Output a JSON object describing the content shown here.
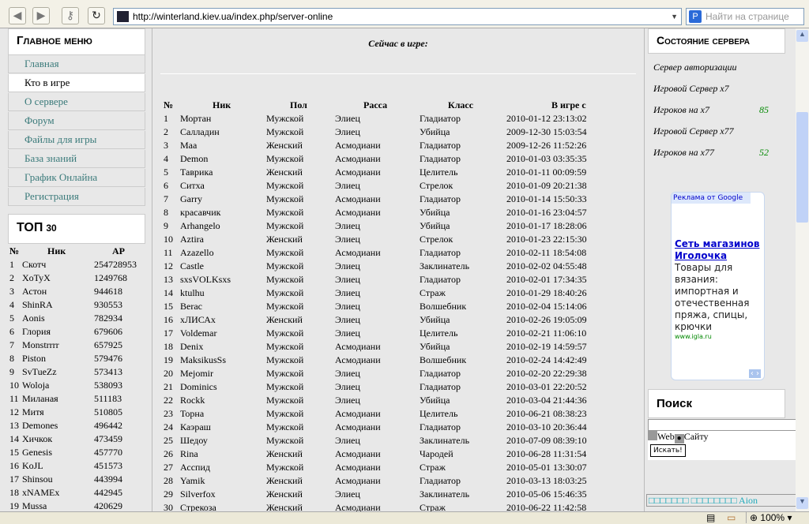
{
  "browser": {
    "url": "http://winterland.kiev.ua/index.php/server-online",
    "find_placeholder": "Найти на странице",
    "zoom": "100%"
  },
  "menu": {
    "title": "Главное меню",
    "items": [
      {
        "label": "Главная"
      },
      {
        "label": "Кто в игре",
        "active": true
      },
      {
        "label": "О сервере"
      },
      {
        "label": "Форум"
      },
      {
        "label": "Файлы для игры"
      },
      {
        "label": "База знаний"
      },
      {
        "label": "График Онлайна"
      },
      {
        "label": "Регистрация"
      }
    ]
  },
  "top": {
    "title": "ТОП",
    "count": "30",
    "headers": [
      "№",
      "Ник",
      "AP"
    ],
    "rows": [
      [
        "1",
        "Скотч",
        "254728953"
      ],
      [
        "2",
        "XoTyX",
        "1249768"
      ],
      [
        "3",
        "Астон",
        "944618"
      ],
      [
        "4",
        "ShinRA",
        "930553"
      ],
      [
        "5",
        "Aonis",
        "782934"
      ],
      [
        "6",
        "Глория",
        "679606"
      ],
      [
        "7",
        "Monstrrrr",
        "657925"
      ],
      [
        "8",
        "Piston",
        "579476"
      ],
      [
        "9",
        "SvTueZz",
        "573413"
      ],
      [
        "10",
        "Woloja",
        "538093"
      ],
      [
        "11",
        "Миланая",
        "511183"
      ],
      [
        "12",
        "Митя",
        "510805"
      ],
      [
        "13",
        "Demones",
        "496442"
      ],
      [
        "14",
        "Хичкок",
        "473459"
      ],
      [
        "15",
        "Genesis",
        "457770"
      ],
      [
        "16",
        "KoJL",
        "451573"
      ],
      [
        "17",
        "Shinsou",
        "443994"
      ],
      [
        "18",
        "xNAMEx",
        "442945"
      ],
      [
        "19",
        "Mussa",
        "420629"
      ]
    ]
  },
  "online": {
    "title": "Сейчас в игре:",
    "headers": [
      "№",
      "Ник",
      "Пол",
      "Расса",
      "Класс",
      "В игре с"
    ],
    "rows": [
      [
        "1",
        "Мортан",
        "Мужской",
        "Элиец",
        "Гладиатор",
        "2010-01-12 23:13:02"
      ],
      [
        "2",
        "Салладин",
        "Мужской",
        "Элиец",
        "Убийца",
        "2009-12-30 15:03:54"
      ],
      [
        "3",
        "Маа",
        "Женский",
        "Асмодиани",
        "Гладиатор",
        "2009-12-26 11:52:26"
      ],
      [
        "4",
        "Demon",
        "Мужской",
        "Асмодиани",
        "Гладиатор",
        "2010-01-03 03:35:35"
      ],
      [
        "5",
        "Таврика",
        "Женский",
        "Асмодиани",
        "Целитель",
        "2010-01-11 00:09:59"
      ],
      [
        "6",
        "Ситха",
        "Мужской",
        "Элиец",
        "Стрелок",
        "2010-01-09 20:21:38"
      ],
      [
        "7",
        "Garry",
        "Мужской",
        "Асмодиани",
        "Гладиатор",
        "2010-01-14 15:50:33"
      ],
      [
        "8",
        "красавчик",
        "Мужской",
        "Асмодиани",
        "Убийца",
        "2010-01-16 23:04:57"
      ],
      [
        "9",
        "Arhangelo",
        "Мужской",
        "Элиец",
        "Убийца",
        "2010-01-17 18:28:06"
      ],
      [
        "10",
        "Aztira",
        "Женский",
        "Элиец",
        "Стрелок",
        "2010-01-23 22:15:30"
      ],
      [
        "11",
        "Azazello",
        "Мужской",
        "Асмодиани",
        "Гладиатор",
        "2010-02-11 18:54:08"
      ],
      [
        "12",
        "Castle",
        "Мужской",
        "Элиец",
        "Заклинатель",
        "2010-02-02 04:55:48"
      ],
      [
        "13",
        "sxsVOLKsxs",
        "Мужской",
        "Элиец",
        "Гладиатор",
        "2010-02-01 17:34:35"
      ],
      [
        "14",
        "ktulhu",
        "Мужской",
        "Элиец",
        "Страж",
        "2010-01-29 18:40:26"
      ],
      [
        "15",
        "Berac",
        "Мужской",
        "Элиец",
        "Волшебник",
        "2010-02-04 15:14:06"
      ],
      [
        "16",
        "xЛИСАx",
        "Женский",
        "Элиец",
        "Убийца",
        "2010-02-26 19:05:09"
      ],
      [
        "17",
        "Voldemar",
        "Мужской",
        "Элиец",
        "Целитель",
        "2010-02-21 11:06:10"
      ],
      [
        "18",
        "Denix",
        "Мужской",
        "Асмодиани",
        "Убийца",
        "2010-02-19 14:59:57"
      ],
      [
        "19",
        "MaksikusSs",
        "Мужской",
        "Асмодиани",
        "Волшебник",
        "2010-02-24 14:42:49"
      ],
      [
        "20",
        "Mejomir",
        "Мужской",
        "Элиец",
        "Гладиатор",
        "2010-02-20 22:29:38"
      ],
      [
        "21",
        "Dominics",
        "Мужской",
        "Элиец",
        "Гладиатор",
        "2010-03-01 22:20:52"
      ],
      [
        "22",
        "Rockk",
        "Мужской",
        "Элиец",
        "Убийца",
        "2010-03-04 21:44:36"
      ],
      [
        "23",
        "Торна",
        "Мужской",
        "Асмодиани",
        "Целитель",
        "2010-06-21 08:38:23"
      ],
      [
        "24",
        "Каэраш",
        "Мужской",
        "Асмодиани",
        "Гладиатор",
        "2010-03-10 20:36:44"
      ],
      [
        "25",
        "Шедоу",
        "Мужской",
        "Элиец",
        "Заклинатель",
        "2010-07-09 08:39:10"
      ],
      [
        "26",
        "Rina",
        "Женский",
        "Асмодиани",
        "Чародей",
        "2010-06-28 11:31:54"
      ],
      [
        "27",
        "Асспид",
        "Мужской",
        "Асмодиани",
        "Страж",
        "2010-05-01 13:30:07"
      ],
      [
        "28",
        "Yamik",
        "Женский",
        "Асмодиани",
        "Гладиатор",
        "2010-03-13 18:03:25"
      ],
      [
        "29",
        "Silverfox",
        "Женский",
        "Элиец",
        "Заклинатель",
        "2010-05-06 15:46:35"
      ],
      [
        "30",
        "Стрекоза",
        "Женский",
        "Асмодиани",
        "Страж",
        "2010-06-22 11:42:58"
      ]
    ]
  },
  "server": {
    "title": "Состояние сервера",
    "lines": [
      {
        "label": "Сервер авторизации"
      },
      {
        "label": "Игровой Сервер x7"
      },
      {
        "label": "Игроков на x7",
        "value": "85"
      },
      {
        "label": "Игровой Сервер x77"
      },
      {
        "label": "Игроков на x77",
        "value": "52"
      }
    ]
  },
  "ad": {
    "header": "Реклама от Google",
    "link": "Сеть магазинов Иголочка",
    "text": "Товары для вязания: импортная и отечественная пряжа, спицы, крючки",
    "domain": "www.igla.ru"
  },
  "search": {
    "title": "Поиск",
    "opt_web": "Web",
    "opt_site": "Сайту",
    "button": "Искать!"
  },
  "footer_link": "□□□□□□□ □□□□□□□□ Aion",
  "colors": {
    "menu_link": "#3a7a7a",
    "online_count": "#008800",
    "ad_link": "#0000cc"
  }
}
